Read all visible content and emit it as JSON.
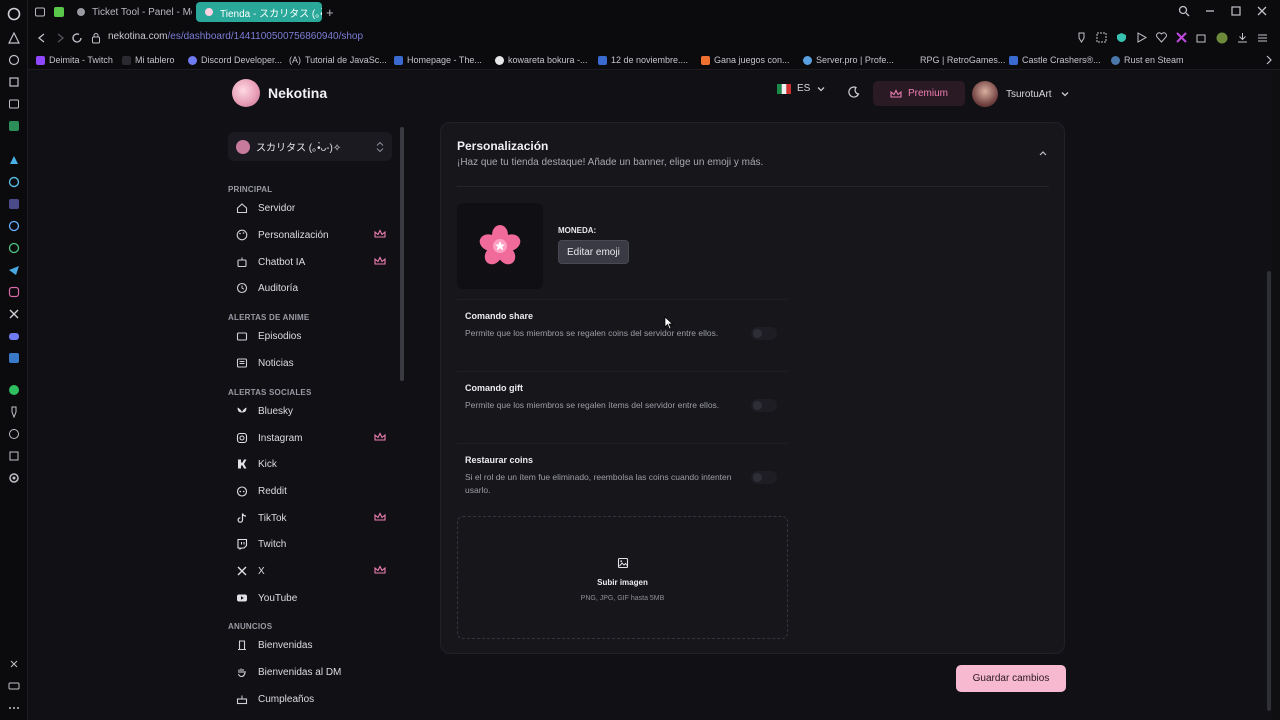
{
  "browser": {
    "tabs": [
      {
        "title": "Ticket Tool - Panel - Men",
        "active": false
      },
      {
        "title": "Tienda - スカリタス (｡•̀ᴗ-)✧",
        "active": true
      }
    ],
    "new_tab": "+",
    "url_host": "nekotina.com",
    "url_path": "/es/dashboard/1441100500756860940/shop",
    "bookmarks": [
      "Deimita - Twitch",
      "Mi tablero",
      "Discord Developer...",
      "Tutorial de JavaSc...",
      "Homepage - The...",
      "kowareta bokura -...",
      "12 de noviembre....",
      "Gana juegos con...",
      "Server.pro | Profe...",
      "RPG | RetroGames...",
      "Castle Crashers®...",
      "Rust en Steam"
    ]
  },
  "header": {
    "brand": "Nekotina",
    "language": "ES",
    "premium_label": "Premium",
    "username": "TsurotuArt"
  },
  "sidebar": {
    "server_name": "スカリタス (｡•̀ᴗ-)✧",
    "sections": {
      "principal": "PRINCIPAL",
      "anime": "ALERTAS DE ANIME",
      "social": "ALERTAS SOCIALES",
      "anuncios": "ANUNCIOS"
    },
    "items": [
      {
        "label": "Servidor",
        "premium": false
      },
      {
        "label": "Personalización",
        "premium": true
      },
      {
        "label": "Chatbot IA",
        "premium": true
      },
      {
        "label": "Auditoría",
        "premium": false
      },
      {
        "label": "Episodios",
        "premium": false
      },
      {
        "label": "Noticias",
        "premium": false
      },
      {
        "label": "Bluesky",
        "premium": false
      },
      {
        "label": "Instagram",
        "premium": true
      },
      {
        "label": "Kick",
        "premium": false
      },
      {
        "label": "Reddit",
        "premium": false
      },
      {
        "label": "TikTok",
        "premium": true
      },
      {
        "label": "Twitch",
        "premium": false
      },
      {
        "label": "X",
        "premium": true
      },
      {
        "label": "YouTube",
        "premium": false
      },
      {
        "label": "Bienvenidas",
        "premium": false
      },
      {
        "label": "Bienvenidas al DM",
        "premium": false
      },
      {
        "label": "Cumpleaños",
        "premium": false
      }
    ]
  },
  "panel": {
    "title": "Personalización",
    "subtitle": "¡Haz que tu tienda destaque! Añade un banner, elige un emoji y más.",
    "currency_label": "MONEDA:",
    "edit_emoji": "Editar emoji",
    "options": [
      {
        "title": "Comando share",
        "desc": "Permite que los miembros se regalen coins del servidor entre ellos.",
        "enabled": false
      },
      {
        "title": "Comando gift",
        "desc": "Permite que los miembros se regalen ítems del servidor entre ellos.",
        "enabled": false
      },
      {
        "title": "Restaurar coins",
        "desc": "Si el rol de un ítem fue eliminado, reembolsa las coins cuando intenten usarlo.",
        "enabled": false
      }
    ],
    "upload_title": "Subir imagen",
    "upload_desc": "PNG, JPG, GIF hasta 5MB"
  },
  "save_label": "Guardar cambios",
  "colors": {
    "accent": "#f6b9d0",
    "active_tab": "#2aa89a",
    "premium": "#ef7fb2"
  }
}
